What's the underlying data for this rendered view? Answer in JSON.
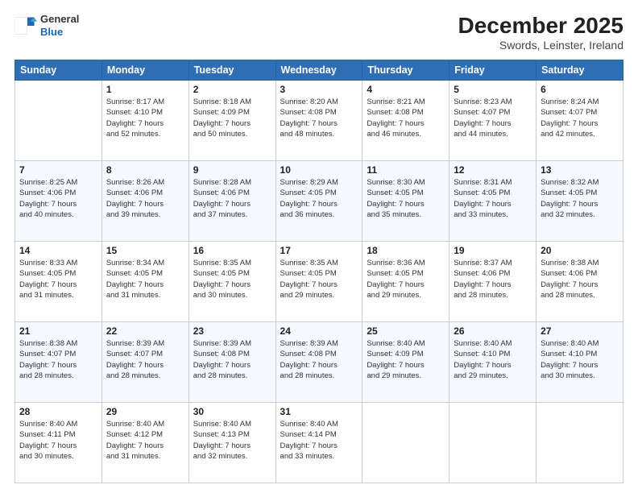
{
  "logo": {
    "general": "General",
    "blue": "Blue"
  },
  "title": "December 2025",
  "subtitle": "Swords, Leinster, Ireland",
  "days_of_week": [
    "Sunday",
    "Monday",
    "Tuesday",
    "Wednesday",
    "Thursday",
    "Friday",
    "Saturday"
  ],
  "weeks": [
    [
      {
        "day": "",
        "info": ""
      },
      {
        "day": "1",
        "info": "Sunrise: 8:17 AM\nSunset: 4:10 PM\nDaylight: 7 hours\nand 52 minutes."
      },
      {
        "day": "2",
        "info": "Sunrise: 8:18 AM\nSunset: 4:09 PM\nDaylight: 7 hours\nand 50 minutes."
      },
      {
        "day": "3",
        "info": "Sunrise: 8:20 AM\nSunset: 4:08 PM\nDaylight: 7 hours\nand 48 minutes."
      },
      {
        "day": "4",
        "info": "Sunrise: 8:21 AM\nSunset: 4:08 PM\nDaylight: 7 hours\nand 46 minutes."
      },
      {
        "day": "5",
        "info": "Sunrise: 8:23 AM\nSunset: 4:07 PM\nDaylight: 7 hours\nand 44 minutes."
      },
      {
        "day": "6",
        "info": "Sunrise: 8:24 AM\nSunset: 4:07 PM\nDaylight: 7 hours\nand 42 minutes."
      }
    ],
    [
      {
        "day": "7",
        "info": ""
      },
      {
        "day": "8",
        "info": "Sunrise: 8:26 AM\nSunset: 4:06 PM\nDaylight: 7 hours\nand 39 minutes."
      },
      {
        "day": "9",
        "info": "Sunrise: 8:28 AM\nSunset: 4:06 PM\nDaylight: 7 hours\nand 37 minutes."
      },
      {
        "day": "10",
        "info": "Sunrise: 8:29 AM\nSunset: 4:05 PM\nDaylight: 7 hours\nand 36 minutes."
      },
      {
        "day": "11",
        "info": "Sunrise: 8:30 AM\nSunset: 4:05 PM\nDaylight: 7 hours\nand 35 minutes."
      },
      {
        "day": "12",
        "info": "Sunrise: 8:31 AM\nSunset: 4:05 PM\nDaylight: 7 hours\nand 33 minutes."
      },
      {
        "day": "13",
        "info": "Sunrise: 8:32 AM\nSunset: 4:05 PM\nDaylight: 7 hours\nand 32 minutes."
      }
    ],
    [
      {
        "day": "14",
        "info": ""
      },
      {
        "day": "15",
        "info": "Sunrise: 8:34 AM\nSunset: 4:05 PM\nDaylight: 7 hours\nand 31 minutes."
      },
      {
        "day": "16",
        "info": "Sunrise: 8:35 AM\nSunset: 4:05 PM\nDaylight: 7 hours\nand 30 minutes."
      },
      {
        "day": "17",
        "info": "Sunrise: 8:35 AM\nSunset: 4:05 PM\nDaylight: 7 hours\nand 29 minutes."
      },
      {
        "day": "18",
        "info": "Sunrise: 8:36 AM\nSunset: 4:05 PM\nDaylight: 7 hours\nand 29 minutes."
      },
      {
        "day": "19",
        "info": "Sunrise: 8:37 AM\nSunset: 4:06 PM\nDaylight: 7 hours\nand 28 minutes."
      },
      {
        "day": "20",
        "info": "Sunrise: 8:38 AM\nSunset: 4:06 PM\nDaylight: 7 hours\nand 28 minutes."
      }
    ],
    [
      {
        "day": "21",
        "info": ""
      },
      {
        "day": "22",
        "info": "Sunrise: 8:39 AM\nSunset: 4:07 PM\nDaylight: 7 hours\nand 28 minutes."
      },
      {
        "day": "23",
        "info": "Sunrise: 8:39 AM\nSunset: 4:08 PM\nDaylight: 7 hours\nand 28 minutes."
      },
      {
        "day": "24",
        "info": "Sunrise: 8:39 AM\nSunset: 4:08 PM\nDaylight: 7 hours\nand 28 minutes."
      },
      {
        "day": "25",
        "info": "Sunrise: 8:40 AM\nSunset: 4:09 PM\nDaylight: 7 hours\nand 29 minutes."
      },
      {
        "day": "26",
        "info": "Sunrise: 8:40 AM\nSunset: 4:10 PM\nDaylight: 7 hours\nand 29 minutes."
      },
      {
        "day": "27",
        "info": "Sunrise: 8:40 AM\nSunset: 4:10 PM\nDaylight: 7 hours\nand 30 minutes."
      }
    ],
    [
      {
        "day": "28",
        "info": "Sunrise: 8:40 AM\nSunset: 4:11 PM\nDaylight: 7 hours\nand 30 minutes."
      },
      {
        "day": "29",
        "info": "Sunrise: 8:40 AM\nSunset: 4:12 PM\nDaylight: 7 hours\nand 31 minutes."
      },
      {
        "day": "30",
        "info": "Sunrise: 8:40 AM\nSunset: 4:13 PM\nDaylight: 7 hours\nand 32 minutes."
      },
      {
        "day": "31",
        "info": "Sunrise: 8:40 AM\nSunset: 4:14 PM\nDaylight: 7 hours\nand 33 minutes."
      },
      {
        "day": "",
        "info": ""
      },
      {
        "day": "",
        "info": ""
      },
      {
        "day": "",
        "info": ""
      }
    ]
  ],
  "week7_sunday": "Sunrise: 8:25 AM\nSunset: 4:06 PM\nDaylight: 7 hours\nand 40 minutes.",
  "week14_sunday": "Sunrise: 8:33 AM\nSunset: 4:05 PM\nDaylight: 7 hours\nand 31 minutes.",
  "week21_sunday": "Sunrise: 8:38 AM\nSunset: 4:07 PM\nDaylight: 7 hours\nand 28 minutes."
}
